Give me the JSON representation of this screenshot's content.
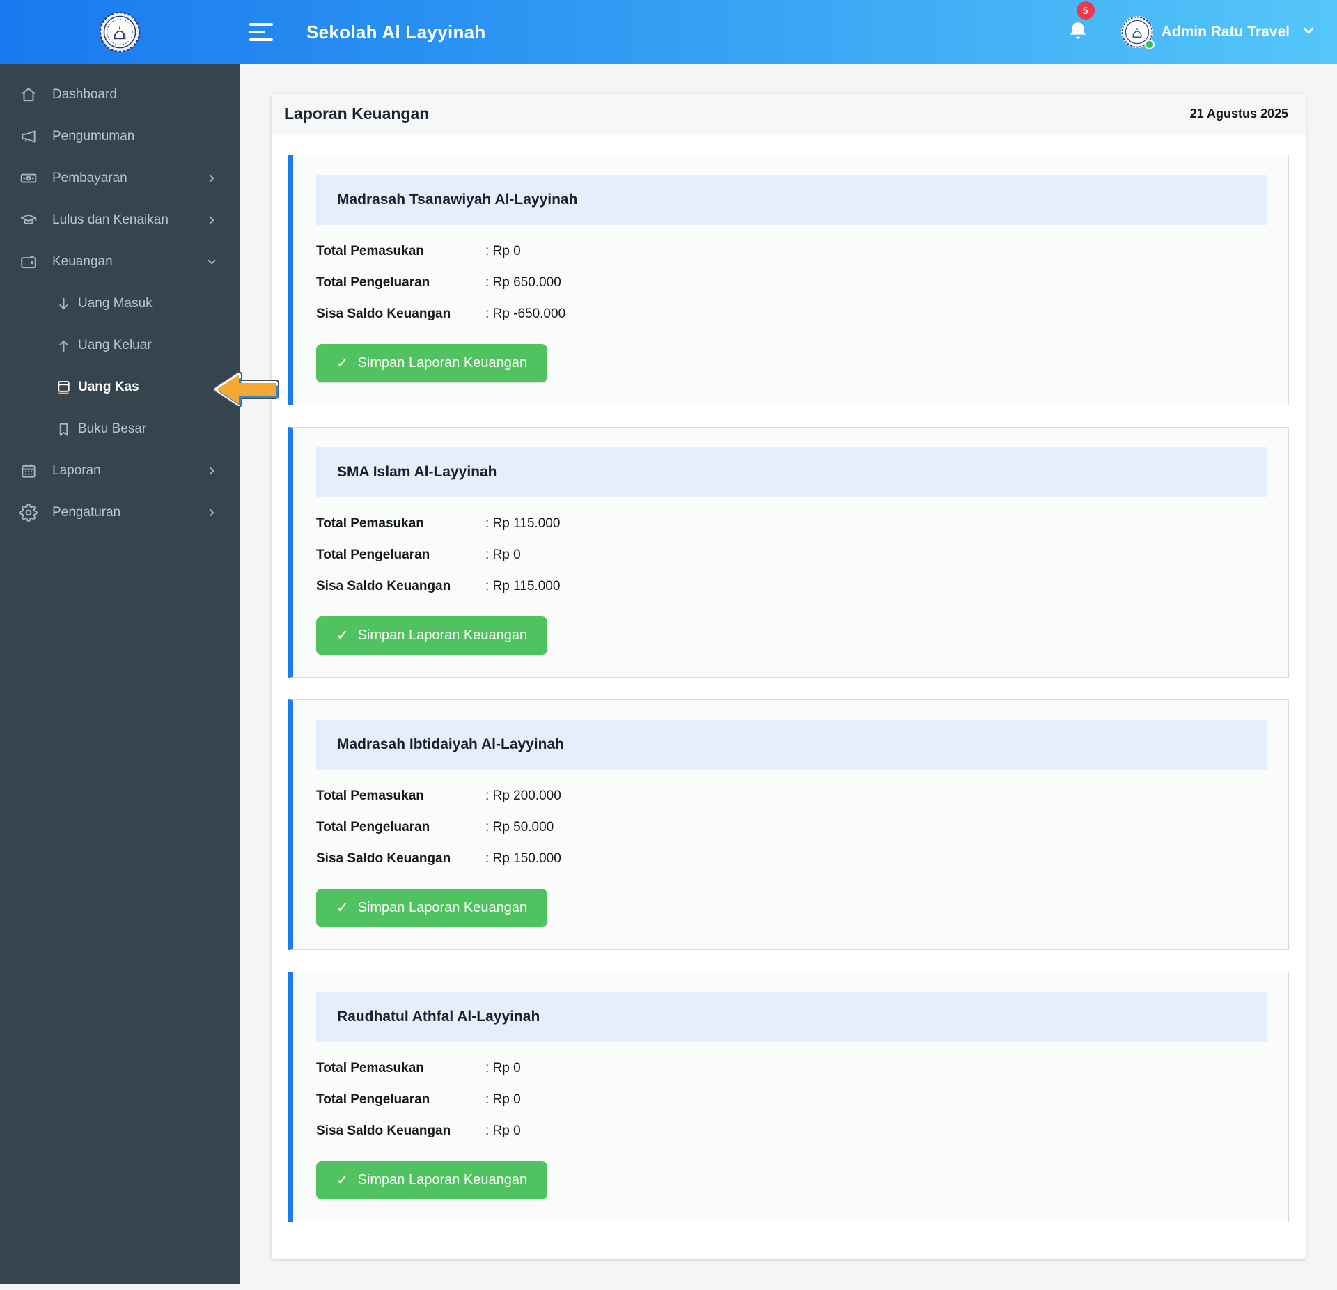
{
  "header": {
    "title": "Sekolah Al Layyinah",
    "notification_count": "5",
    "user_name": "Admin Ratu Travel",
    "logo": "school-emblem",
    "gradient_left": "#1a78ee",
    "gradient_right": "#55c6f9"
  },
  "sidebar": {
    "background": "#35444e",
    "items": [
      {
        "label": "Dashboard",
        "icon": "home-icon",
        "chevron": "none",
        "active": false
      },
      {
        "label": "Pengumuman",
        "icon": "megaphone-icon",
        "chevron": "none",
        "active": false
      },
      {
        "label": "Pembayaran",
        "icon": "banknote-icon",
        "chevron": "right",
        "active": false
      },
      {
        "label": "Lulus dan Kenaikan",
        "icon": "graduation-cap-icon",
        "chevron": "right",
        "active": false
      },
      {
        "label": "Keuangan",
        "icon": "wallet-icon",
        "chevron": "down",
        "active": false
      },
      {
        "label": "Uang Masuk",
        "icon": "arrow-down-icon",
        "chevron": "none",
        "active": false
      },
      {
        "label": "Uang Keluar",
        "icon": "arrow-up-icon",
        "chevron": "none",
        "active": false
      },
      {
        "label": "Uang Kas",
        "icon": "cash-book-icon",
        "chevron": "none",
        "active": true
      },
      {
        "label": "Buku Besar",
        "icon": "bookmark-icon",
        "chevron": "none",
        "active": false
      },
      {
        "label": "Laporan",
        "icon": "calendar-icon",
        "chevron": "right",
        "active": false
      },
      {
        "label": "Pengaturan",
        "icon": "gear-icon",
        "chevron": "right",
        "active": false
      }
    ]
  },
  "page": {
    "title": "Laporan Keuangan",
    "date": "21 Agustus 2025"
  },
  "cards": [
    {
      "school": "Madrasah Tsanawiyah Al-Layyinah",
      "rows": [
        {
          "label": "Total Pemasukan",
          "value": ": Rp 0"
        },
        {
          "label": "Total Pengeluaran",
          "value": ": Rp 650.000"
        },
        {
          "label": "Sisa Saldo Keuangan",
          "value": ": Rp -650.000"
        }
      ],
      "button_check": "✓",
      "button_label": "Simpan Laporan Keuangan"
    },
    {
      "school": "SMA Islam Al-Layyinah",
      "rows": [
        {
          "label": "Total Pemasukan",
          "value": ": Rp 115.000"
        },
        {
          "label": "Total Pengeluaran",
          "value": ": Rp 0"
        },
        {
          "label": "Sisa Saldo Keuangan",
          "value": ": Rp 115.000"
        }
      ],
      "button_check": "✓",
      "button_label": "Simpan Laporan Keuangan"
    },
    {
      "school": "Madrasah Ibtidaiyah Al-Layyinah",
      "rows": [
        {
          "label": "Total Pemasukan",
          "value": ": Rp 200.000"
        },
        {
          "label": "Total Pengeluaran",
          "value": ": Rp 50.000"
        },
        {
          "label": "Sisa Saldo Keuangan",
          "value": ": Rp 150.000"
        }
      ],
      "button_check": "✓",
      "button_label": "Simpan Laporan Keuangan"
    },
    {
      "school": "Raudhatul Athfal Al-Layyinah",
      "rows": [
        {
          "label": "Total Pemasukan",
          "value": ": Rp 0"
        },
        {
          "label": "Total Pengeluaran",
          "value": ": Rp 0"
        },
        {
          "label": "Sisa Saldo Keuangan",
          "value": ": Rp 0"
        }
      ],
      "button_check": "✓",
      "button_label": "Simpan Laporan Keuangan"
    }
  ],
  "colors": {
    "accent_blue": "#1a7cf3",
    "card_band_blue": "#e4eefc",
    "button_green": "#50c25f",
    "badge_red": "#ef3a4e",
    "sidebar_dark": "#35444e",
    "pointer_orange": "#f4a833"
  }
}
